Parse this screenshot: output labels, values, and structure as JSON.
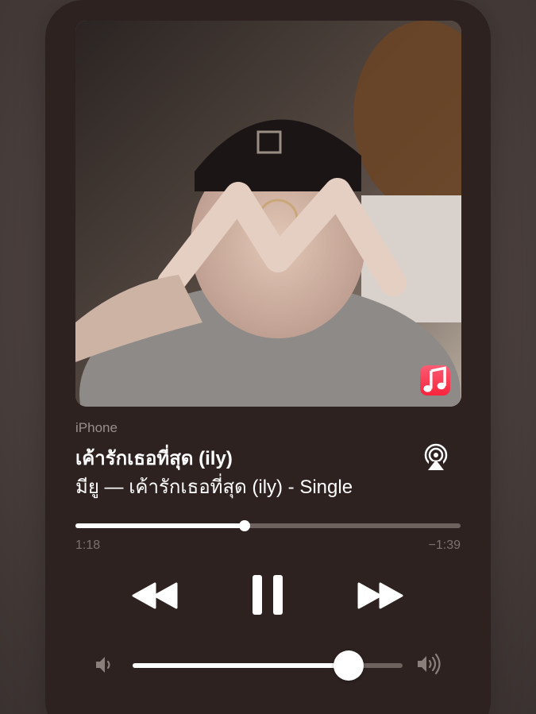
{
  "now_playing": {
    "source": "iPhone",
    "title": "เค้ารักเธอที่สุด (ily)",
    "subtitle": "มียู — เค้ารักเธอที่สุด (ily) - Single",
    "artwork_icon": "person-making-heart-hands-photo",
    "app_badge_icon": "apple-music-icon",
    "airplay_icon": "airplay-audio-icon"
  },
  "playback": {
    "elapsed": "1:18",
    "remaining": "−1:39",
    "progress_fraction": 0.44,
    "state": "playing",
    "controls": {
      "rewind_icon": "rewind-icon",
      "pause_icon": "pause-icon",
      "forward_icon": "fast-forward-icon"
    }
  },
  "volume": {
    "level_fraction": 0.8,
    "min_icon": "speaker-low-icon",
    "max_icon": "speaker-high-icon"
  },
  "colors": {
    "widget_background": "#2d2220",
    "accent": "#ffffff",
    "track_background": "#6e625f",
    "muted_text": "#7c716d",
    "music_badge": "#fa243c"
  }
}
